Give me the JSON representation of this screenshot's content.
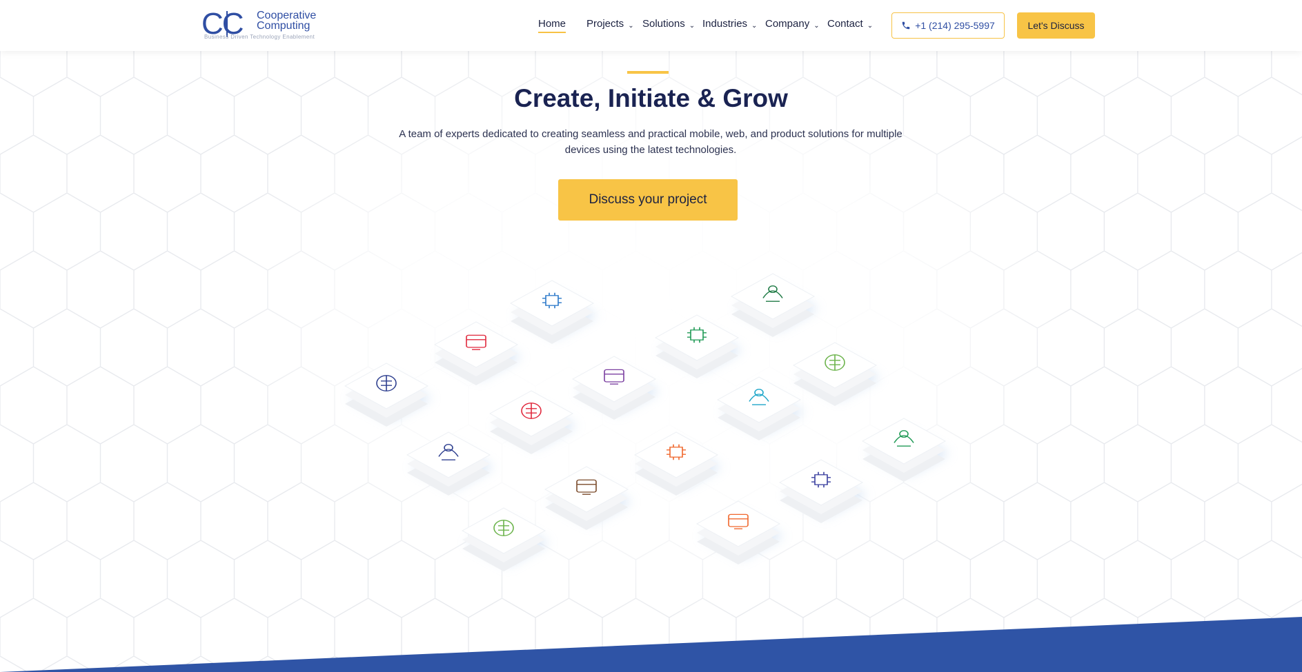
{
  "brand": {
    "logo_letters": "CC",
    "name_line1": "Cooperative",
    "name_line2": "Computing",
    "tagline": "Business Driven Technology Enablement"
  },
  "nav": {
    "items": [
      {
        "label": "Home",
        "has_dropdown": false,
        "active": true
      },
      {
        "label": "Projects",
        "has_dropdown": true
      },
      {
        "label": "Solutions",
        "has_dropdown": true
      },
      {
        "label": "Industries",
        "has_dropdown": true
      },
      {
        "label": "Company",
        "has_dropdown": true
      },
      {
        "label": "Contact",
        "has_dropdown": true
      }
    ],
    "phone": "+1 (214) 295-5997",
    "cta_label": "Let's Discuss"
  },
  "hero": {
    "title": "Create, Initiate & Grow",
    "subtitle_line1": "A team of experts dedicated to creating seamless and practical mobile, web, and product solutions for multiple",
    "subtitle_line2": "devices using the latest technologies.",
    "button_label": "Discuss your project"
  },
  "tiles": [
    {
      "icon": "ai-head-icon",
      "color": "#2e3f8f"
    },
    {
      "icon": "hand-mobile-icon",
      "color": "#e0283c"
    },
    {
      "icon": "chip-circuit-icon",
      "color": "#2b78c9"
    },
    {
      "icon": "network-globe-icon",
      "color": "#2e3f8f"
    },
    {
      "icon": "cloud-devices-icon",
      "color": "#e0283c"
    },
    {
      "icon": "chat-bubbles-icon",
      "color": "#7b3fa0"
    },
    {
      "icon": "security-chip-icon",
      "color": "#1f9a55"
    },
    {
      "icon": "computer-stack-icon",
      "color": "#1f7a45"
    },
    {
      "icon": "drone-icon",
      "color": "#6bb34a"
    },
    {
      "icon": "iot-device-icon",
      "color": "#7a4a2a"
    },
    {
      "icon": "smart-city-icon",
      "color": "#f0672c"
    },
    {
      "icon": "robot-arm-icon",
      "color": "#1ea6c9"
    },
    {
      "icon": "plant-growth-icon",
      "color": "#6bb34a"
    },
    {
      "icon": "robot-head-icon",
      "color": "#f0672c"
    },
    {
      "icon": "cpu-atom-icon",
      "color": "#3a3f9f"
    },
    {
      "icon": "scanner-icon",
      "color": "#1f9a55"
    }
  ],
  "colors": {
    "accent": "#f8c446",
    "brand_blue": "#2f4ea3",
    "heading": "#1a2352"
  }
}
